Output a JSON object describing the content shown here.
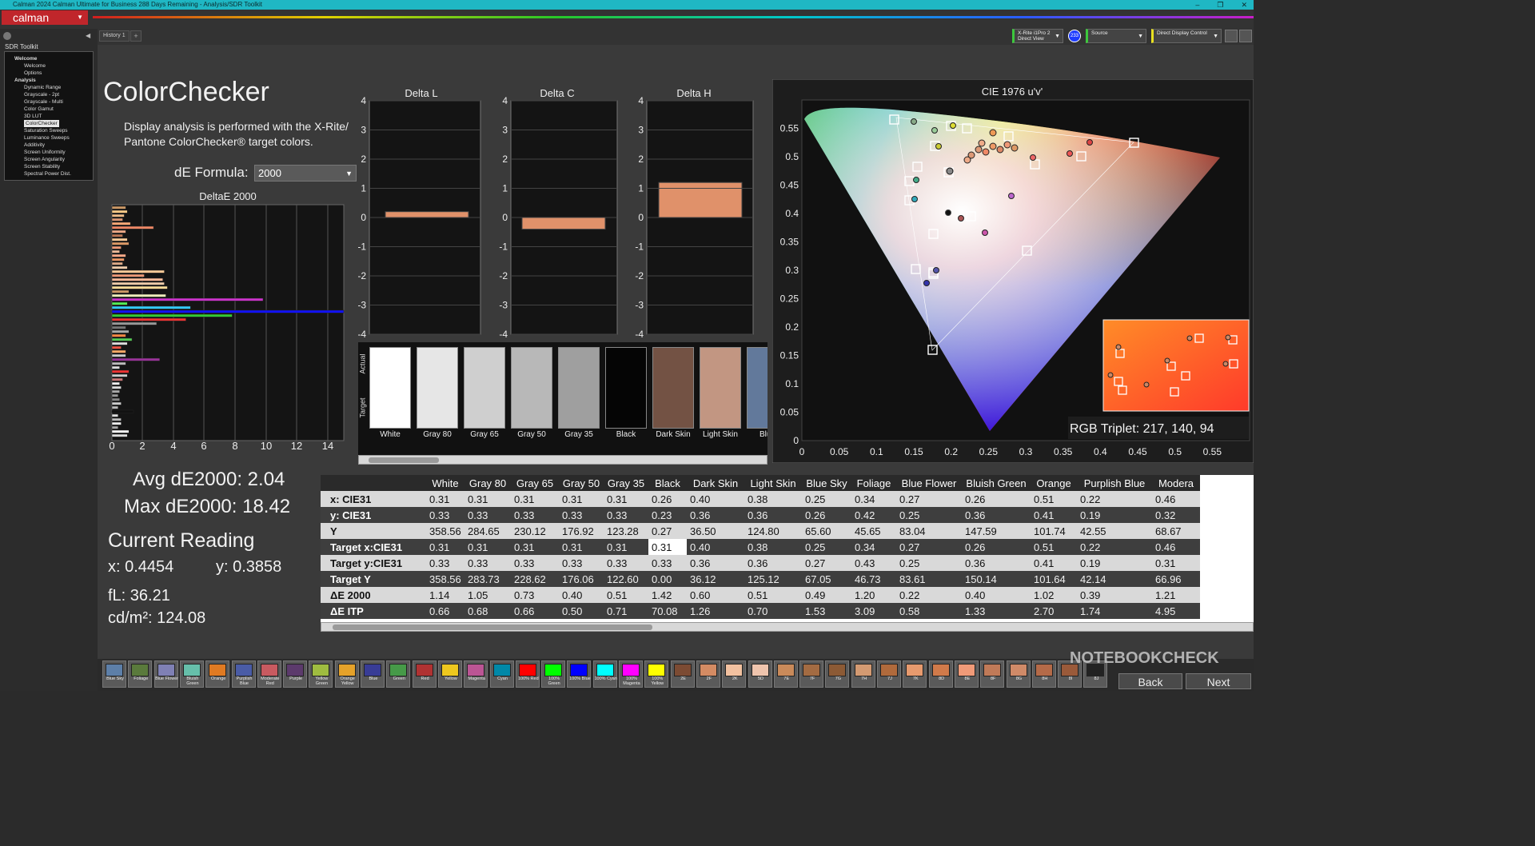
{
  "window": {
    "title": "Calman 2024 Calman Ultimate for Business 288 Days Remaining - Analysis/SDR Toolkit",
    "controls": [
      "–",
      "❐",
      "✕"
    ]
  },
  "app": {
    "logo": "calman"
  },
  "tabs": {
    "history": "History 1",
    "add": "+"
  },
  "devices": {
    "meter_line1": "X-Rite i1Pro 2",
    "meter_line2": "Direct View",
    "meter_badge": "233",
    "source": "Source",
    "display": "Direct Display Control"
  },
  "sidebar": {
    "title": "SDR Toolkit",
    "groups": [
      {
        "label": "Welcome",
        "items": [
          "Welcome",
          "Options"
        ]
      },
      {
        "label": "Analysis",
        "items": [
          "Dynamic Range",
          "Grayscale - 2pt",
          "Grayscale - Multi",
          "Color Gamut",
          "3D LUT",
          "ColorChecker",
          "Saturation Sweeps",
          "Luminance Sweeps",
          "Additivity",
          "Screen Uniformity",
          "Screen Angularity",
          "Screen Stability",
          "Spectral Power Dist."
        ]
      }
    ],
    "selected": "ColorChecker"
  },
  "page": {
    "title": "ColorChecker",
    "description_line1": "Display analysis is performed with the X-Rite/",
    "description_line2": "Pantone ColorChecker® target colors.",
    "de_formula_label": "dE Formula:",
    "de_formula_value": "2000"
  },
  "deltae_chart": {
    "title": "DeltaE 2000",
    "xticks": [
      "0",
      "2",
      "4",
      "6",
      "8",
      "10",
      "12",
      "14"
    ]
  },
  "delta_charts": [
    {
      "title": "Delta L",
      "value": 0.2,
      "color": "#e0916a"
    },
    {
      "title": "Delta C",
      "value": -0.4,
      "color": "#e0916a"
    },
    {
      "title": "Delta H",
      "value": 1.2,
      "color": "#e0916a"
    }
  ],
  "delta_yticks": [
    "4",
    "3",
    "2",
    "1",
    "0",
    "-1",
    "-2",
    "-3",
    "-4"
  ],
  "swatches": {
    "side_actual": "Actual",
    "side_target": "Target",
    "items": [
      {
        "label": "White",
        "color": "#ffffff"
      },
      {
        "label": "Gray 80",
        "color": "#e6e6e6"
      },
      {
        "label": "Gray 65",
        "color": "#cfcfcf"
      },
      {
        "label": "Gray 50",
        "color": "#b8b8b8"
      },
      {
        "label": "Gray 35",
        "color": "#9f9f9f"
      },
      {
        "label": "Black",
        "color": "#050505"
      },
      {
        "label": "Dark Skin",
        "color": "#735244"
      },
      {
        "label": "Light Skin",
        "color": "#c29682"
      },
      {
        "label": "Blue",
        "color": "#62799b"
      }
    ]
  },
  "summary": {
    "avg": "Avg dE2000: 2.04",
    "max": "Max dE2000: 18.42",
    "current_title": "Current Reading",
    "x": "x: 0.4454",
    "y": "y: 0.3858",
    "fl": "fL: 36.21",
    "cdm2": "cd/m²: 124.08"
  },
  "cie": {
    "title": "CIE 1976 u'v'",
    "xticks": [
      "0",
      "0.05",
      "0.1",
      "0.15",
      "0.2",
      "0.25",
      "0.3",
      "0.35",
      "0.4",
      "0.45",
      "0.5",
      "0.55"
    ],
    "yticks": [
      "0",
      "0.05",
      "0.1",
      "0.15",
      "0.2",
      "0.25",
      "0.3",
      "0.35",
      "0.4",
      "0.45",
      "0.5",
      "0.55"
    ],
    "rgb_triplet": "RGB Triplet: 217, 140, 94"
  },
  "table": {
    "columns": [
      "White",
      "Gray 80",
      "Gray 65",
      "Gray 50",
      "Gray 35",
      "Black",
      "Dark Skin",
      "Light Skin",
      "Blue Sky",
      "Foliage",
      "Blue Flower",
      "Bluish Green",
      "Orange",
      "Purplish Blue",
      "Modera"
    ],
    "rows": [
      {
        "label": "x: CIE31",
        "values": [
          "0.31",
          "0.31",
          "0.31",
          "0.31",
          "0.31",
          "0.26",
          "0.40",
          "0.38",
          "0.25",
          "0.34",
          "0.27",
          "0.26",
          "0.51",
          "0.22",
          "0.46"
        ]
      },
      {
        "label": "y: CIE31",
        "values": [
          "0.33",
          "0.33",
          "0.33",
          "0.33",
          "0.33",
          "0.23",
          "0.36",
          "0.36",
          "0.26",
          "0.42",
          "0.25",
          "0.36",
          "0.41",
          "0.19",
          "0.32"
        ]
      },
      {
        "label": "Y",
        "values": [
          "358.56",
          "284.65",
          "230.12",
          "176.92",
          "123.28",
          "0.27",
          "36.50",
          "124.80",
          "65.60",
          "45.65",
          "83.04",
          "147.59",
          "101.74",
          "42.55",
          "68.67"
        ]
      },
      {
        "label": "Target x:CIE31",
        "values": [
          "0.31",
          "0.31",
          "0.31",
          "0.31",
          "0.31",
          "0.31",
          "0.40",
          "0.38",
          "0.25",
          "0.34",
          "0.27",
          "0.26",
          "0.51",
          "0.22",
          "0.46"
        ]
      },
      {
        "label": "Target y:CIE31",
        "values": [
          "0.33",
          "0.33",
          "0.33",
          "0.33",
          "0.33",
          "0.33",
          "0.36",
          "0.36",
          "0.27",
          "0.43",
          "0.25",
          "0.36",
          "0.41",
          "0.19",
          "0.31"
        ]
      },
      {
        "label": "Target Y",
        "values": [
          "358.56",
          "283.73",
          "228.62",
          "176.06",
          "122.60",
          "0.00",
          "36.12",
          "125.12",
          "67.05",
          "46.73",
          "83.61",
          "150.14",
          "101.64",
          "42.14",
          "66.96"
        ]
      },
      {
        "label": "ΔE 2000",
        "values": [
          "1.14",
          "1.05",
          "0.73",
          "0.40",
          "0.51",
          "1.42",
          "0.60",
          "0.51",
          "0.49",
          "1.20",
          "0.22",
          "0.40",
          "1.02",
          "0.39",
          "1.21"
        ]
      },
      {
        "label": "ΔE ITP",
        "values": [
          "0.66",
          "0.68",
          "0.66",
          "0.50",
          "0.71",
          "70.08",
          "1.26",
          "0.70",
          "1.53",
          "3.09",
          "0.58",
          "1.33",
          "2.70",
          "1.74",
          "4.95"
        ]
      }
    ]
  },
  "strip": [
    {
      "label": "Blue Sky",
      "color": "#5d7fa8"
    },
    {
      "label": "Foliage",
      "color": "#5a7a3c"
    },
    {
      "label": "Blue Flower",
      "color": "#7f80b4"
    },
    {
      "label": "Bluish Green",
      "color": "#66bfaa"
    },
    {
      "label": "Orange",
      "color": "#e07a22"
    },
    {
      "label": "Purplish Blue",
      "color": "#4a5ca6"
    },
    {
      "label": "Moderate Red",
      "color": "#c85a60"
    },
    {
      "label": "Purple",
      "color": "#5c3a6c"
    },
    {
      "label": "Yellow Green",
      "color": "#9fbc40"
    },
    {
      "label": "Orange Yellow",
      "color": "#e5a22a"
    },
    {
      "label": "Blue",
      "color": "#383c96"
    },
    {
      "label": "Green",
      "color": "#469a48"
    },
    {
      "label": "Red",
      "color": "#b03232"
    },
    {
      "label": "Yellow",
      "color": "#eec81e"
    },
    {
      "label": "Magenta",
      "color": "#bb5594"
    },
    {
      "label": "Cyan",
      "color": "#0088a8"
    },
    {
      "label": "100% Red",
      "color": "#ff0000"
    },
    {
      "label": "100% Green",
      "color": "#00ff00"
    },
    {
      "label": "100% Blue",
      "color": "#0000ff"
    },
    {
      "label": "100% Cyan",
      "color": "#00ffff"
    },
    {
      "label": "100% Magenta",
      "color": "#ff00ff"
    },
    {
      "label": "100% Yellow",
      "color": "#ffff00"
    },
    {
      "label": "2E",
      "color": "#7c4b33"
    },
    {
      "label": "2F",
      "color": "#d48b63"
    },
    {
      "label": "2K",
      "color": "#f2c1a0"
    },
    {
      "label": "5D",
      "color": "#efc4ad"
    },
    {
      "label": "7E",
      "color": "#c98a5a"
    },
    {
      "label": "7F",
      "color": "#a36b42"
    },
    {
      "label": "7G",
      "color": "#8c5a35"
    },
    {
      "label": "7H",
      "color": "#d39a72"
    },
    {
      "label": "7J",
      "color": "#b06a3c"
    },
    {
      "label": "7K",
      "color": "#e79a6e"
    },
    {
      "label": "8D",
      "color": "#d07a4a"
    },
    {
      "label": "8E",
      "color": "#f09a78"
    },
    {
      "label": "8F",
      "color": "#c07a58"
    },
    {
      "label": "8G",
      "color": "#d08a68"
    },
    {
      "label": "8H",
      "color": "#b46a48"
    },
    {
      "label": "8I",
      "color": "#9a5a3a"
    },
    {
      "label": "8J",
      "color": "#222222"
    }
  ],
  "nav": {
    "back": "Back",
    "next": "Next"
  },
  "watermark": "NOTEBOOKCHECK"
}
